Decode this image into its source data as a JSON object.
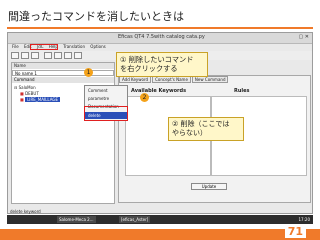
{
  "slide": {
    "title": "間違ったコマンドを消したいときは",
    "page_number": "71",
    "colors": {
      "accent": "#f07a2a",
      "callout_bg": "#fff7c9",
      "highlight_box": "#e02020",
      "selection": "#2a4fb8"
    }
  },
  "window": {
    "title": "Eficas QT4 7.5with catalog  cata.py",
    "controls": "▢ ✕",
    "menu": [
      "File",
      "Edit",
      "JdC",
      "Help",
      "Translation",
      "Options"
    ],
    "toolbar_icons": [
      "new-icon",
      "open-icon",
      "save-icon",
      "cut-icon",
      "copy-icon",
      "paste-icon",
      "delete-icon"
    ]
  },
  "left_pane": {
    "header_label": "Name",
    "name_value": "No name 1",
    "tree_header": "Command",
    "tree": [
      {
        "label": "SaloMon",
        "indent": 0
      },
      {
        "label": "DEBUT",
        "indent": 1
      },
      {
        "label": "LIRE_MAILLAGE",
        "indent": 1,
        "selected": true
      }
    ]
  },
  "right_pane": {
    "tabs": [
      "Add Keyword",
      "Concept's Name",
      "New Command"
    ],
    "available_keywords_label": "Available Keywords",
    "rules_label": "Rules",
    "update_button": "Update"
  },
  "context_menu": {
    "items": [
      "Comment",
      "parametre",
      "Documentation",
      "delete"
    ],
    "active_index": 3
  },
  "callouts": [
    {
      "text_line1": "① 削除したいコマンド",
      "text_line2": "を右クリックする"
    },
    {
      "text_line1": "② 削除（ここでは",
      "text_line2": "やらない）"
    }
  ],
  "badges": [
    "1",
    "2"
  ],
  "statusbar": {
    "text": "delete keyword"
  },
  "taskbar": {
    "items": [
      "Salome-Meca 2...",
      "[eficas_Aster]"
    ],
    "clock": "17:20"
  }
}
